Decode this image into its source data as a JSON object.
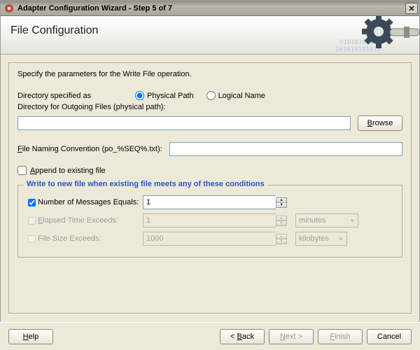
{
  "window": {
    "title": "Adapter Configuration Wizard - Step 5 of 7"
  },
  "header": {
    "page_title": "File Configuration"
  },
  "intro": "Specify the parameters for the Write File operation.",
  "dir_spec": {
    "label": "Directory specified as",
    "radio_physical": "Physical Path",
    "radio_logical": "Logical Name",
    "selected": "physical"
  },
  "outgoing": {
    "label": "Directory for Outgoing Files (physical path):",
    "value": "",
    "browse_u": "B",
    "browse_rest": "rowse"
  },
  "naming": {
    "label_u": "F",
    "label_rest": "ile Naming Convention (po_%SEQ%.txt):",
    "value": ""
  },
  "append": {
    "label_u": "A",
    "label_rest": "ppend to existing file",
    "checked": false
  },
  "conditions": {
    "legend": "Write to new file when existing file meets any of these conditions",
    "num_msgs": {
      "label": "Number of Messages Equals:",
      "value": "1",
      "checked": true
    },
    "elapsed": {
      "label_u": "E",
      "label_rest": "lapsed Time Exceeds:",
      "value": "1",
      "unit": "minutes",
      "checked": false
    },
    "filesize": {
      "label": "File Size Exceeds:",
      "value": "1000",
      "unit": "kilobytes",
      "checked": false
    }
  },
  "footer": {
    "help_u": "H",
    "help_rest": "elp",
    "back": "< Back",
    "back_u": "B",
    "next_u": "N",
    "next_rest": "ext >",
    "finish_u": "F",
    "finish_rest": "inish",
    "cancel": "Cancel"
  }
}
